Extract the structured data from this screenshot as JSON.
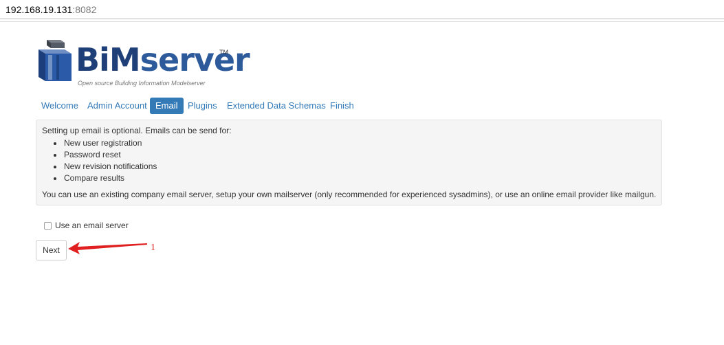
{
  "address_bar": {
    "host": "192.168.19.131",
    "port": ":8082"
  },
  "logo": {
    "name_bim": "BiM",
    "name_server": "server",
    "trademark": "TM",
    "tagline": "Open source Building Information Modelserver"
  },
  "tabs": [
    {
      "label": "Welcome",
      "active": false
    },
    {
      "label": "Admin Account",
      "active": false
    },
    {
      "label": "Email",
      "active": true
    },
    {
      "label": "Plugins",
      "active": false
    },
    {
      "label": "Extended Data Schemas",
      "active": false
    },
    {
      "label": "Finish",
      "active": false
    }
  ],
  "info": {
    "intro": "Setting up email is optional. Emails can be send for:",
    "items": [
      "New user registration",
      "Password reset",
      "New revision notifications",
      "Compare results"
    ],
    "outro": "You can use an existing company email server, setup your own mailserver (only recommended for experienced sysadmins), or use an online email provider like mailgun."
  },
  "email_server_checkbox": {
    "label": "Use an email server",
    "checked": false
  },
  "next_button": {
    "label": "Next"
  },
  "annotation": {
    "number": "1",
    "color": "#e02020"
  },
  "colors": {
    "accent": "#337ab7",
    "logo_dark": "#1e3f78",
    "logo_blue": "#2d5a9a"
  }
}
